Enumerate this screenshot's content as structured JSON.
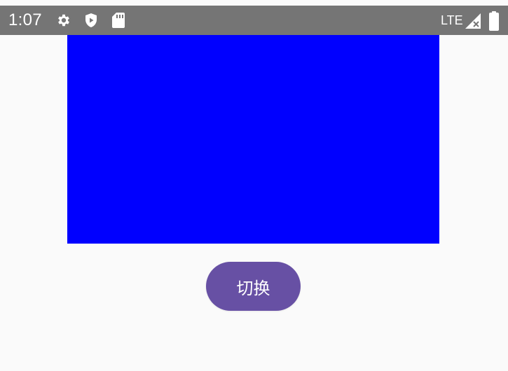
{
  "status_bar": {
    "time": "1:07",
    "network": "LTE",
    "icons": [
      "gear-icon",
      "shield-play-icon",
      "sd-card-icon",
      "signal-no-data-icon",
      "battery-icon"
    ]
  },
  "content": {
    "block_color": "#0000ff"
  },
  "toggle_button": {
    "label": "切换",
    "color": "#6750a4"
  },
  "colors": {
    "status_bar": "#757575",
    "background": "#fafafa"
  }
}
